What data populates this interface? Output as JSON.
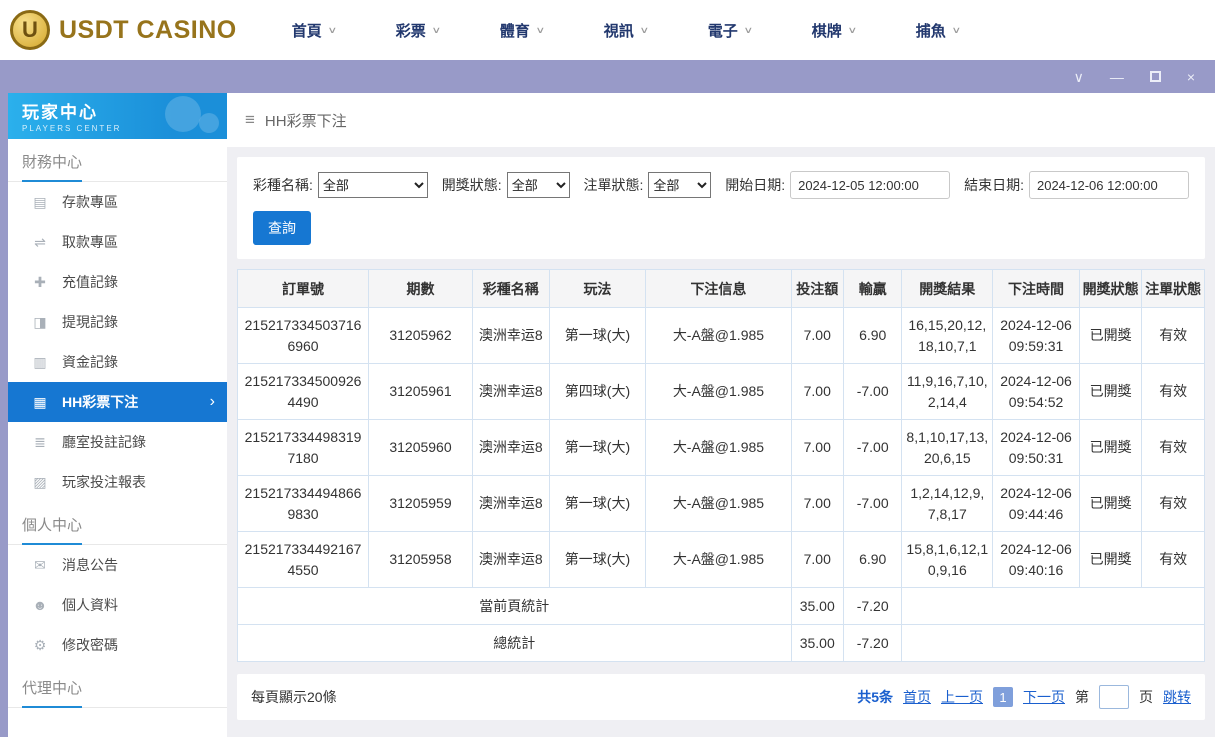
{
  "colors": {
    "accent_blue": "#1677d2",
    "titlebar_purple": "#989ac8",
    "sidebar_header_blue": "#1b8fd9",
    "table_border": "#d4e2f1",
    "logo_gold": "#97741c"
  },
  "topnav": {
    "logo_text": "USDT CASINO",
    "logo_letter": "U",
    "items": [
      {
        "name": "home",
        "label": "首頁"
      },
      {
        "name": "lottery",
        "label": "彩票"
      },
      {
        "name": "sports",
        "label": "體育"
      },
      {
        "name": "live-video",
        "label": "視訊"
      },
      {
        "name": "slots",
        "label": "電子"
      },
      {
        "name": "chess-cards",
        "label": "棋牌"
      },
      {
        "name": "fishing",
        "label": "捕魚"
      }
    ]
  },
  "sidebar": {
    "title": "玩家中心",
    "subtitle": "PLAYERS CENTER",
    "sections": [
      {
        "name": "finance-center",
        "label": "財務中心",
        "items": [
          {
            "name": "deposit-area",
            "label": "存款專區",
            "icon": "deposit-icon",
            "glyph": "▤",
            "active": false
          },
          {
            "name": "withdraw-area",
            "label": "取款專區",
            "icon": "withdraw-icon",
            "glyph": "⇌",
            "active": false
          },
          {
            "name": "recharge-records",
            "label": "充值記錄",
            "icon": "recharge-icon",
            "glyph": "✚",
            "active": false
          },
          {
            "name": "withdrawal-records",
            "label": "提現記錄",
            "icon": "cashout-icon",
            "glyph": "◨",
            "active": false
          },
          {
            "name": "funds-records",
            "label": "資金記錄",
            "icon": "funds-icon",
            "glyph": "▥",
            "active": false
          },
          {
            "name": "hh-lottery-bets",
            "label": "HH彩票下注",
            "icon": "lottery-bet-icon",
            "glyph": "▦",
            "active": true
          },
          {
            "name": "hall-bet-records",
            "label": "廳室投註記錄",
            "icon": "hall-records-icon",
            "glyph": "≣",
            "active": false
          },
          {
            "name": "player-bet-report",
            "label": "玩家投注報表",
            "icon": "report-icon",
            "glyph": "▨",
            "active": false
          }
        ]
      },
      {
        "name": "personal-center",
        "label": "個人中心",
        "items": [
          {
            "name": "announcements",
            "label": "消息公告",
            "icon": "bell-icon",
            "glyph": "✉",
            "active": false
          },
          {
            "name": "profile",
            "label": "個人資料",
            "icon": "user-icon",
            "glyph": "☻",
            "active": false
          },
          {
            "name": "change-password",
            "label": "修改密碼",
            "icon": "gear-icon",
            "glyph": "⚙",
            "active": false
          }
        ]
      },
      {
        "name": "agent-center",
        "label": "代理中心",
        "items": []
      }
    ]
  },
  "window": {
    "collapse_icon": "∨",
    "minimize_icon": "—",
    "close_icon": "×"
  },
  "content": {
    "breadcrumb": "HH彩票下注",
    "filters": {
      "lottery_label": "彩種名稱:",
      "lottery_value": "全部",
      "draw_status_label": "開獎狀態:",
      "draw_status_value": "全部",
      "order_status_label": "注單狀態:",
      "order_status_value": "全部",
      "start_label": "開始日期:",
      "start_value": "2024-12-05 12:00:00",
      "end_label": "結束日期:",
      "end_value": "2024-12-06 12:00:00",
      "search_button": "查詢"
    },
    "table": {
      "headers": [
        "訂單號",
        "期數",
        "彩種名稱",
        "玩法",
        "下注信息",
        "投注額",
        "輸贏",
        "開獎結果",
        "下注時間",
        "開獎狀態",
        "注單狀態"
      ],
      "rows": [
        [
          "2152173345037166960",
          "31205962",
          "澳洲幸运8",
          "第一球(大)",
          "大-A盤@1.985",
          "7.00",
          "6.90",
          "16,15,20,12,18,10,7,1",
          "2024-12-06 09:59:31",
          "已開獎",
          "有效"
        ],
        [
          "2152173345009264490",
          "31205961",
          "澳洲幸运8",
          "第四球(大)",
          "大-A盤@1.985",
          "7.00",
          "-7.00",
          "11,9,16,7,10,2,14,4",
          "2024-12-06 09:54:52",
          "已開獎",
          "有效"
        ],
        [
          "2152173344983197180",
          "31205960",
          "澳洲幸运8",
          "第一球(大)",
          "大-A盤@1.985",
          "7.00",
          "-7.00",
          "8,1,10,17,13,20,6,15",
          "2024-12-06 09:50:31",
          "已開獎",
          "有效"
        ],
        [
          "2152173344948669830",
          "31205959",
          "澳洲幸运8",
          "第一球(大)",
          "大-A盤@1.985",
          "7.00",
          "-7.00",
          "1,2,14,12,9,7,8,17",
          "2024-12-06 09:44:46",
          "已開獎",
          "有效"
        ],
        [
          "2152173344921674550",
          "31205958",
          "澳洲幸运8",
          "第一球(大)",
          "大-A盤@1.985",
          "7.00",
          "6.90",
          "15,8,1,6,12,10,9,16",
          "2024-12-06 09:40:16",
          "已開獎",
          "有效"
        ]
      ],
      "page_total_label": "當前頁統計",
      "page_total_bet": "35.00",
      "page_total_winloss": "-7.20",
      "grand_total_label": "總統計",
      "grand_total_bet": "35.00",
      "grand_total_winloss": "-7.20"
    },
    "pagination": {
      "per_page": "每頁顯示20條",
      "total": "共5条",
      "first": "首页",
      "prev": "上一页",
      "current": "1",
      "next": "下一页",
      "page_label": "第",
      "page_suffix": "页",
      "jump": "跳转"
    }
  }
}
